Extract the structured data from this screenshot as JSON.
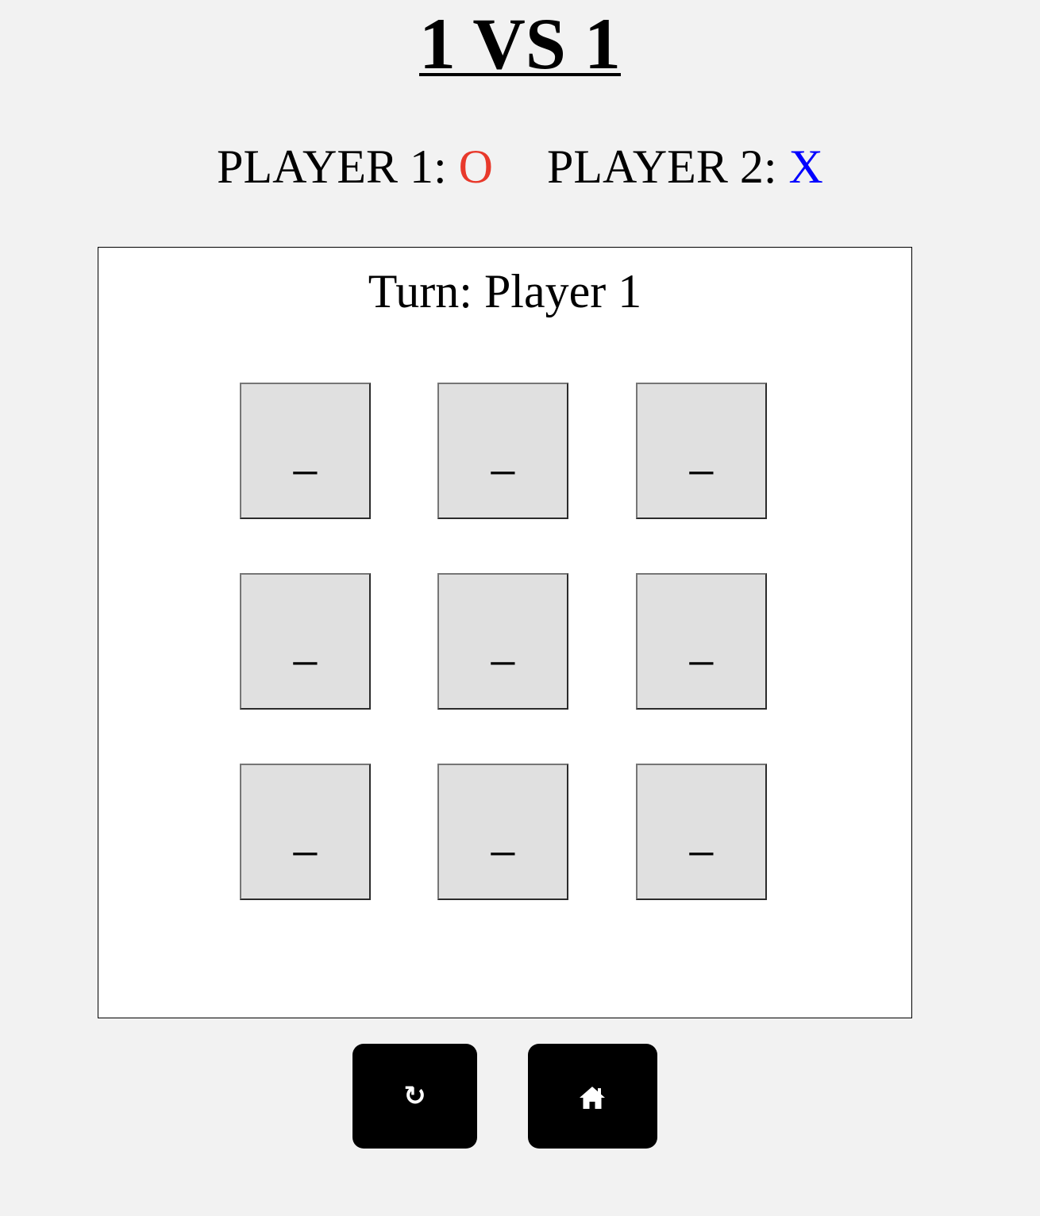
{
  "header": {
    "title": "1 VS 1"
  },
  "players": {
    "p1_label": "PLAYER 1:",
    "p1_mark": "O",
    "p1_color": "#e8392b",
    "p2_label": "PLAYER 2:",
    "p2_mark": "X",
    "p2_color": "#0000ff"
  },
  "turn": {
    "text": "Turn: Player 1"
  },
  "board": {
    "cells": [
      "_",
      "_",
      "_",
      "_",
      "_",
      "_",
      "_",
      "_",
      "_"
    ]
  },
  "controls": {
    "restart_icon": "restart-icon",
    "restart_glyph": "↻",
    "home_icon": "home-icon"
  }
}
